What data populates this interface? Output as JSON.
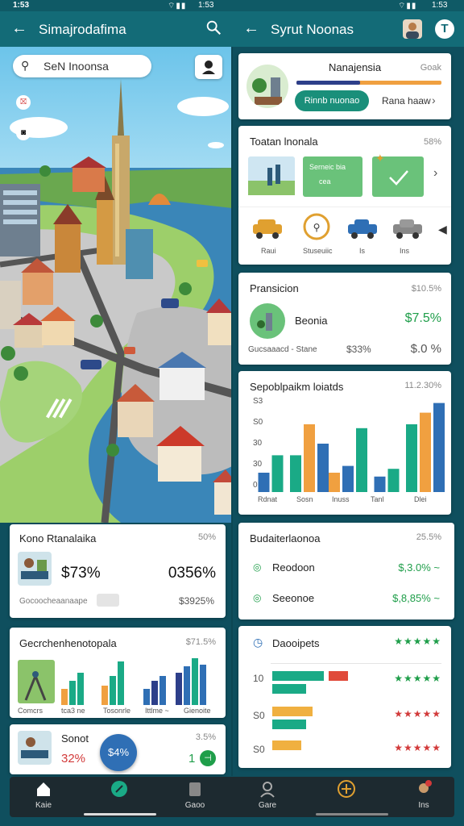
{
  "status": {
    "time": "1:53"
  },
  "left_header": {
    "title": "Simajrodafima"
  },
  "right_header": {
    "title": "Syrut Noonas"
  },
  "map": {
    "search_text": "SeN Inoonsa"
  },
  "left_panel1": {
    "title": "Kono Rtanalaika",
    "meta": "50%",
    "value_a": "$73%",
    "value_b": "0356%",
    "label": "Gocoocheaanaape",
    "sub": "$3925%"
  },
  "left_panel2": {
    "title": "Gecrchenhenotopala",
    "meta": "$71.5%",
    "labels": [
      "Comcrs",
      "tca3 ne",
      "Tosonrle",
      "Ittlme ~",
      "Gienoite"
    ]
  },
  "left_panel3": {
    "title": "Sonot",
    "meta": "3.5%",
    "value": "32%",
    "button": "$4%",
    "right_value": "1"
  },
  "right_panel1": {
    "title": "Nanajensia",
    "meta": "Goak",
    "button": "Rinnb nuonao",
    "link": "Rana haaw"
  },
  "right_panel2": {
    "title": "Toatan lnonala",
    "meta": "58%",
    "card_text": "Serneic bia",
    "card_sub": "cea",
    "vehicles": [
      "Raui",
      "Stuseuiic",
      "Is",
      "Ins"
    ]
  },
  "right_panel3": {
    "title": "Pransicion",
    "meta": "$10.5%",
    "row_label": "Beonia",
    "row_value": "$7.5%",
    "sub_label": "Gucsaaacd - Stane",
    "sub_value": "$33%",
    "sub_value2": "$.0 %"
  },
  "right_panel4": {
    "title": "Sepoblpaikm loiatds",
    "meta": "11.2.30%",
    "yticks": [
      "S3",
      "S0",
      "30",
      "30",
      "0"
    ],
    "xlabels": [
      "Rdnat",
      "Sosn",
      "Inuss",
      "Tanl",
      "Dlei"
    ]
  },
  "right_panel5": {
    "title": "Budaiterlaonoa",
    "meta": "25.5%",
    "rows": [
      {
        "label": "Reodoon",
        "value": "$,3.0% ~"
      },
      {
        "label": "Seeonoe",
        "value": "$,8,85% ~"
      }
    ]
  },
  "right_panel6": {
    "title": "Daooipets",
    "y": [
      "10",
      "S0",
      "S0"
    ]
  },
  "chart_data": {
    "type": "bar",
    "title": "Sepoblpaikm loiatds",
    "categories": [
      "Rdnat",
      "Sosn",
      "Inuss",
      "Tanl",
      "Dlei"
    ],
    "series": [
      {
        "values": [
          20,
          38,
          20,
          16,
          70
        ]
      },
      {
        "values": [
          38,
          70,
          27,
          24,
          82
        ]
      },
      {
        "values": [
          0,
          50,
          66,
          0,
          92
        ]
      }
    ],
    "ylim": [
      0,
      100
    ]
  },
  "nav": {
    "items": [
      "Kaie",
      "",
      "Gaoo",
      "Gare",
      "",
      "Ins"
    ]
  },
  "colors": {
    "header": "#136b77",
    "accent": "#1f9e4a",
    "chart_teal": "#1aaa86",
    "chart_orange": "#f0a040",
    "chart_navy": "#2d3f8a",
    "chart_blue": "#2f6fb5"
  }
}
